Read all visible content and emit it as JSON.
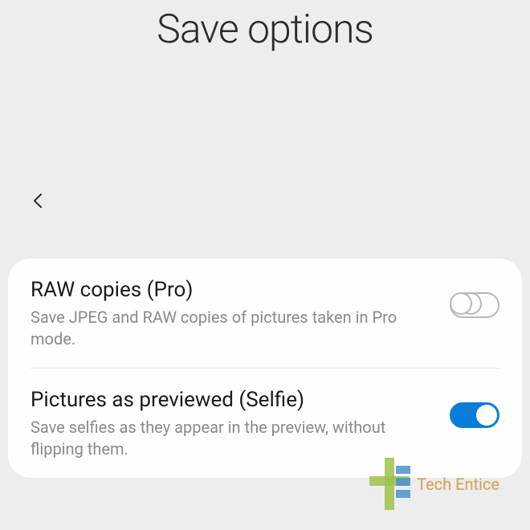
{
  "header": {
    "title": "Save options"
  },
  "settings": {
    "items": [
      {
        "title": "RAW copies (Pro)",
        "subtitle": "Save JPEG and RAW copies of pictures taken in Pro mode.",
        "enabled": false
      },
      {
        "title": "Pictures as previewed (Selfie)",
        "subtitle": "Save selfies as they appear in the preview, without flipping them.",
        "enabled": true
      }
    ]
  },
  "watermark": {
    "text": "Tech Entice"
  }
}
